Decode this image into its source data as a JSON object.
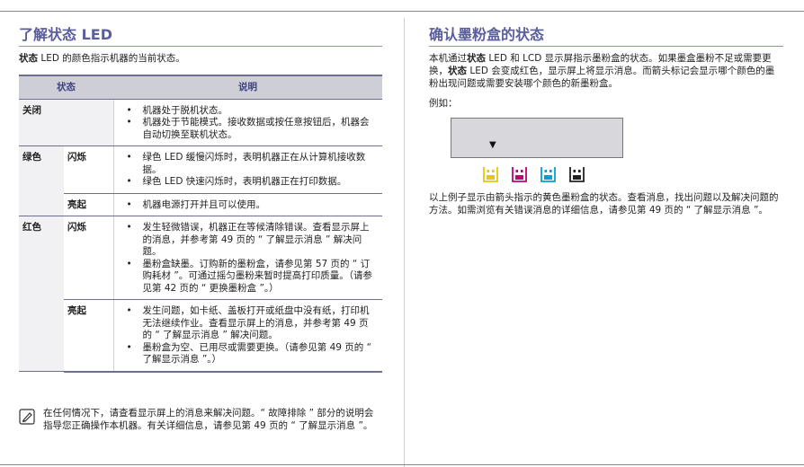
{
  "left": {
    "heading": "了解状态 LED",
    "intro_bold": "状态",
    "intro_rest": " LED 的颜色指示机器的当前状态。",
    "table": {
      "headers": [
        "状态",
        "说明"
      ],
      "rows": {
        "off": {
          "color": "关闭",
          "mode": "",
          "items": [
            "机器处于脱机状态。",
            "机器处于节能模式。接收数据或按任意按钮后，机器会自动切换至联机状态。"
          ]
        },
        "green_blink": {
          "color": "绿色",
          "mode": "闪烁",
          "items": [
            "绿色 LED 缓慢闪烁时，表明机器正在从计算机接收数据。",
            "绿色 LED 快速闪烁时，表明机器正在打印数据。"
          ]
        },
        "green_on": {
          "color": "",
          "mode": "亮起",
          "items": [
            "机器电源打开并且可以使用。"
          ]
        },
        "red_blink": {
          "color": "红色",
          "mode": "闪烁",
          "items": [
            "发生轻微错误，机器正在等候清除错误。查看显示屏上的消息，并参考第  49  页的 “ 了解显示消息 ” 解决问题。",
            "墨粉盒缺墨。订购新的墨粉盒，请参见第  57  页的 “ 订购耗材 ”。可通过摇匀墨粉来暂时提高打印质量。（请参见第  42  页的 “ 更换墨粉盒 ”。）"
          ]
        },
        "red_on": {
          "color": "",
          "mode": "亮起",
          "items": [
            "发生问题，如卡纸、盖板打开或纸盘中没有纸，打印机无法继续作业。查看显示屏上的消息，并参考第  49  页的 “ 了解显示消息 ” 解决问题。",
            "墨粉盒为空、已用尽或需要更换。（请参见第  49  页的 “ 了解显示消息 ”。）"
          ]
        }
      }
    },
    "note": "在任何情况下，请查看显示屏上的消息来解决问题。“ 故障排除 ” 部分的说明会指导您正确操作本机器。有关详细信息，请参见第  49  页的 “ 了解显示消息 ”。"
  },
  "right": {
    "heading": "确认墨粉盒的状态",
    "p1_a": "本机通过",
    "p1_b1": "状态",
    "p1_c": " LED 和 LCD 显示屏指示墨粉盒的状态。如果墨盒墨粉不足或需要更换，",
    "p1_b2": "状态",
    "p1_d": " LED 会变成红色，显示屏上将显示消息。而箭头标记会显示哪个颜色的墨粉出现问题或需要安装哪个颜色的新墨粉盒。",
    "example_label": "例如：",
    "lcd_arrow": "▼",
    "toners": [
      "yellow",
      "magenta",
      "cyan",
      "black"
    ],
    "toner_colors": {
      "yellow": "#e8c800",
      "magenta": "#c2007a",
      "cyan": "#009fdc",
      "black": "#222222"
    },
    "after": "以上例子显示由箭头指示的黄色墨粉盒的状态。查看消息，找出问题以及解决问题的方法。如需浏览有关错误消息的详细信息，请参见第  49  页的 “ 了解显示消息 ”。"
  },
  "colors": {
    "heading": "#5b5e9c",
    "table_header_bg": "#cdced6",
    "rule": "#6d6f8f"
  }
}
